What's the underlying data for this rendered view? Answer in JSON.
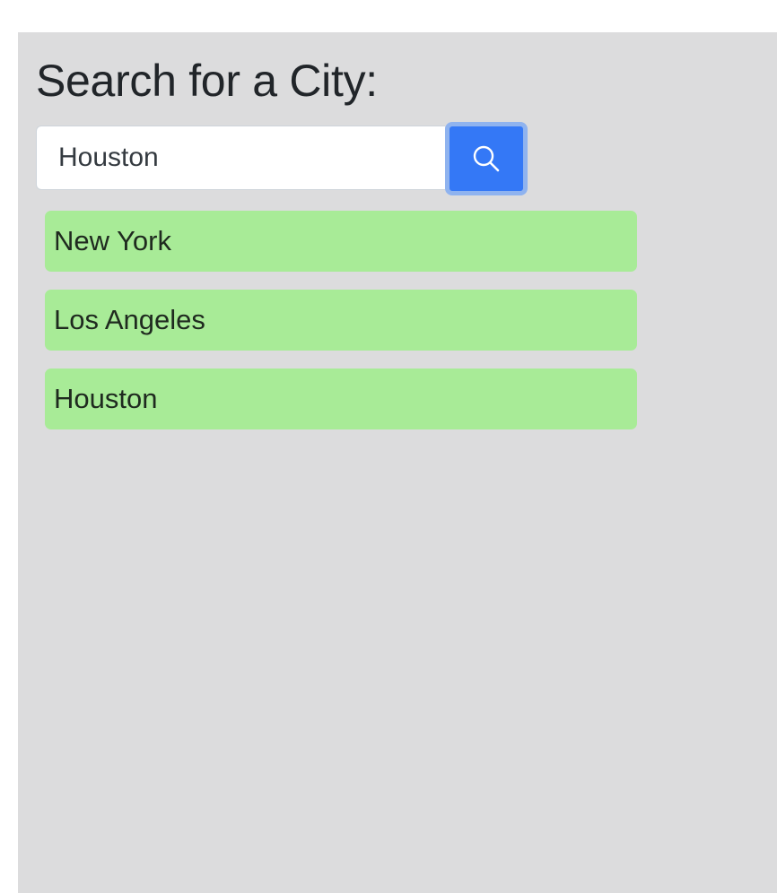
{
  "header": {
    "title": "Search for a City:"
  },
  "search": {
    "value": "Houston",
    "button_icon": "search-icon",
    "button_color": "#3478f6"
  },
  "cities": [
    {
      "label": "New York"
    },
    {
      "label": "Los Angeles"
    },
    {
      "label": "Houston"
    }
  ],
  "colors": {
    "panel_background": "#dcdcdd",
    "city_item_background": "#a8eb97"
  }
}
